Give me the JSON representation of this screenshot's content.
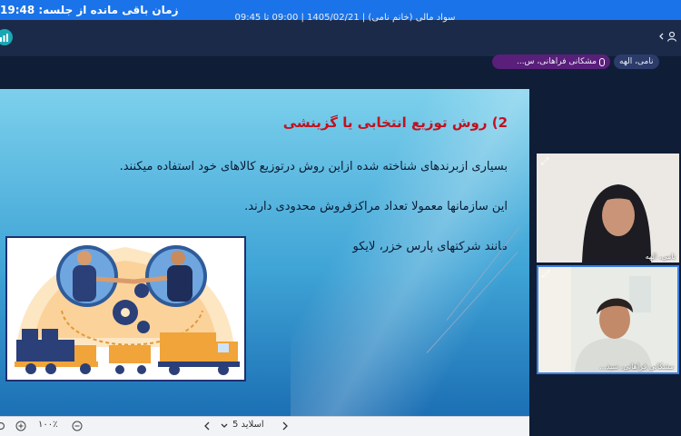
{
  "banner": {
    "text": "زمان باقی مانده از جلسه: 19:48"
  },
  "header": {
    "title": "سواد مالی (خانم نامی) | 1405/02/21 | 09:00 تا 09:45"
  },
  "participants": [
    {
      "name": "نامی، الهه",
      "color": "#2c3c6a"
    },
    {
      "name": "مشکانی فراهانی، س...",
      "color": "#5a1f7a"
    }
  ],
  "slide": {
    "heading": "2) روش توزیع انتخابی یا گزینشی",
    "lines": [
      "بسیاری ازبرندهای شناخته شده ازاین روش درتوزیع کالاهای خود استفاده میکنند.",
      "این سازمانها معمولا تعداد مراکزفروش محدودی دارند.",
      "مانند شرکتهای پارس خزر، لایکو"
    ]
  },
  "toolbar": {
    "zoom": "۱۰۰٪",
    "slide_label": "اسلاید 5"
  },
  "videos": [
    {
      "name": "نامی، الهه"
    },
    {
      "name": "مشکانی فراهانی، سید..."
    }
  ],
  "icons": {
    "logo": "chart-bars-icon",
    "user": "user-icon",
    "back": "chevron-left-icon",
    "mic": "mic-icon",
    "expand": "expand-icon",
    "zoom_in": "zoom-in-icon",
    "zoom_out": "zoom-out-icon",
    "prev": "chevron-left-icon",
    "next": "chevron-right-icon",
    "dropdown": "chevron-down-icon"
  }
}
